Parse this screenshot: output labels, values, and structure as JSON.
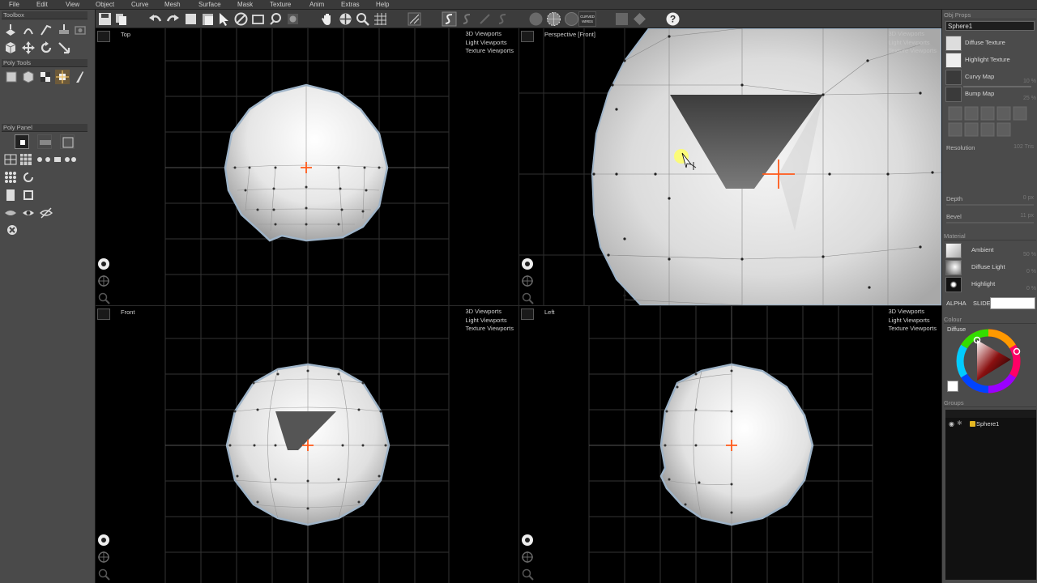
{
  "menu": [
    "File",
    "Edit",
    "View",
    "Object",
    "Curve",
    "Mesh",
    "Surface",
    "Mask",
    "Texture",
    "Anim",
    "Extras",
    "Help"
  ],
  "toolbox": {
    "title": "Toolbox",
    "poly_tools_title": "Poly Tools",
    "poly_panel_title": "Poly Panel"
  },
  "toolbar": {
    "curved_wires_label": "CURVED WIRES"
  },
  "viewports": {
    "top": {
      "title": "Top",
      "links": [
        "3D Viewports",
        "Light Viewports",
        "Texture Viewports"
      ]
    },
    "perspective": {
      "title": "Perspective [Front]",
      "links": [
        "3D Viewports",
        "Light Viewports",
        "Texture Viewports"
      ]
    },
    "front": {
      "title": "Front",
      "links": [
        "3D Viewports",
        "Light Viewports",
        "Texture Viewports"
      ]
    },
    "left": {
      "title": "Left",
      "links": [
        "3D Viewports",
        "Light Viewports",
        "Texture Viewports"
      ]
    }
  },
  "obj_props": {
    "title": "Obj Props",
    "object_name": "Sphere1",
    "textures": [
      {
        "label": "Diffuse Texture"
      },
      {
        "label": "Highlight Texture"
      },
      {
        "label": "Curvy Map",
        "value": "10 %"
      },
      {
        "label": "Bump Map",
        "value": "25 %"
      }
    ],
    "resolution_label": "Resolution",
    "resolution_value": "102 Tris",
    "depth_label": "Depth",
    "depth_value": "0 px",
    "bevel_label": "Bevel",
    "bevel_value": "11 px"
  },
  "material": {
    "title": "Material",
    "rows": [
      {
        "label": "Ambient",
        "value": "50 %"
      },
      {
        "label": "Diffuse Light",
        "value": "0 %"
      },
      {
        "label": "Highlight",
        "value": "0 %"
      }
    ],
    "alpha_label": "ALPHA",
    "alpha_mode": "SLIDE"
  },
  "colour": {
    "title": "Colour",
    "diffuse_label": "Diffuse"
  },
  "groups": {
    "title": "Groups",
    "items": [
      {
        "name": "Sphere1"
      }
    ]
  },
  "colors": {
    "panel": "#4a4a4a",
    "viewport_bg": "#000000",
    "grid": "#3a3a3a",
    "mesh_outline": "#9fb4c8",
    "pivot": "#ff5a1a",
    "highlight_cursor": "#ffff66"
  }
}
